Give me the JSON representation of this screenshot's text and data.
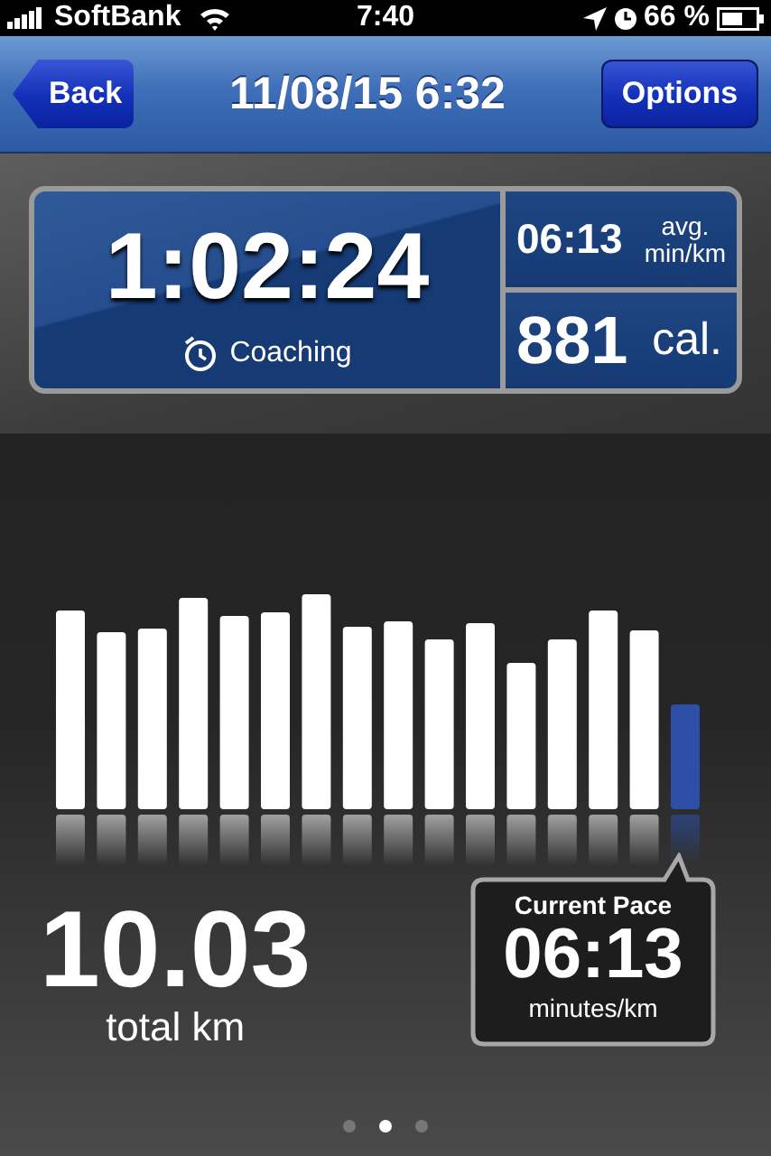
{
  "status_bar": {
    "carrier": "SoftBank",
    "time": "7:40",
    "battery": "66 %"
  },
  "nav": {
    "back": "Back",
    "title": "11/08/15 6:32",
    "options": "Options"
  },
  "summary": {
    "duration": "1:02:24",
    "coaching": "Coaching",
    "avg_pace": "06:13",
    "avg_label": "avg.",
    "avg_unit": "min/km",
    "calories": "881",
    "calories_unit": "cal."
  },
  "distance": {
    "value": "10.03",
    "unit": "total km"
  },
  "current_pace": {
    "title": "Current Pace",
    "value": "06:13",
    "unit": "minutes/km"
  },
  "pager": [
    {
      "selected": false
    },
    {
      "selected": true
    },
    {
      "selected": false
    }
  ]
}
